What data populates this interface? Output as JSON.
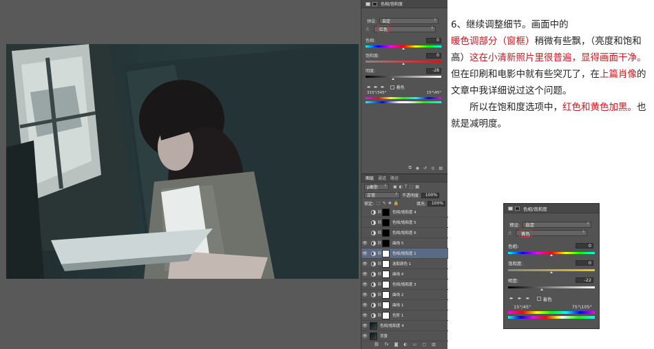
{
  "props": {
    "title": "色相/饱和度",
    "preset_label": "预设:",
    "preset_value": "自定",
    "channel_value": "红色",
    "hue_label": "色相:",
    "hue_value": "0",
    "sat_label": "饱和度:",
    "sat_value": "0",
    "light_label": "明度:",
    "light_value": "-28",
    "colorize_label": "着色",
    "range_left": "315°/345°",
    "range_right": "15°\\45°"
  },
  "layers": {
    "tabs": [
      "图层",
      "通道",
      "路径"
    ],
    "filter_label": "ρ类型",
    "blend_mode": "正常",
    "opacity_label": "不透明度:",
    "opacity_value": "100%",
    "lock_label": "锁定:",
    "fill_label": "填充:",
    "fill_value": "100%",
    "items": [
      {
        "name": "色相/饱和度 4",
        "visible": false
      },
      {
        "name": "色相/饱和度 5",
        "visible": false
      },
      {
        "name": "色相/饱和度 6",
        "visible": false
      },
      {
        "name": "曲线 5",
        "visible": true
      },
      {
        "name": "色相/饱和度 1",
        "visible": true,
        "selected": true
      },
      {
        "name": "选取颜色 1",
        "visible": true
      },
      {
        "name": "曲线 4",
        "visible": true
      },
      {
        "name": "色相/饱和度 3",
        "visible": true
      },
      {
        "name": "曲线 2",
        "visible": true
      },
      {
        "name": "曲线 1",
        "visible": true
      },
      {
        "name": "色阶 1",
        "visible": true
      },
      {
        "name": "色相/饱和度 4",
        "visible": true
      },
      {
        "name": "背景",
        "visible": true
      }
    ],
    "footer_icons": [
      "link-icon",
      "fx-icon",
      "mask-icon",
      "adjustment-icon",
      "folder-icon",
      "new-layer-icon",
      "trash-icon"
    ]
  },
  "article": {
    "p1_a": "6、继续调整细节。画面中的",
    "p1_b": "暖色调部分（窗框）",
    "p1_c": "稍微有些飘，（亮度和饱和高）",
    "p1_d": "这在小清新照片里很普遍，显得画面干净。",
    "p1_e": "但在印刷和电影中就有些突兀了，在",
    "p1_f": "上篇肖像",
    "p1_g": "的文章中我详细说过这个问题。",
    "p2_a": "所以在饱和度选项中，",
    "p2_b": "红色和黄色加黑。",
    "p2_c": "也就是减明度。"
  },
  "inset": {
    "title": "色相/饱和度",
    "preset_label": "预设:",
    "preset_value": "自定",
    "channel_value": "黄色",
    "hue_label": "色相:",
    "hue_value": "0",
    "sat_label": "饱和度:",
    "sat_value": "0",
    "light_label": "明度:",
    "light_value": "-22",
    "colorize_label": "着色",
    "range_left": "15°/45°",
    "range_right": "75°\\105°"
  },
  "colors": {
    "accent_red": "#c8191f",
    "panel_bg": "#535353",
    "canvas_bg": "#595959",
    "selected_layer": "#5b6b86"
  }
}
